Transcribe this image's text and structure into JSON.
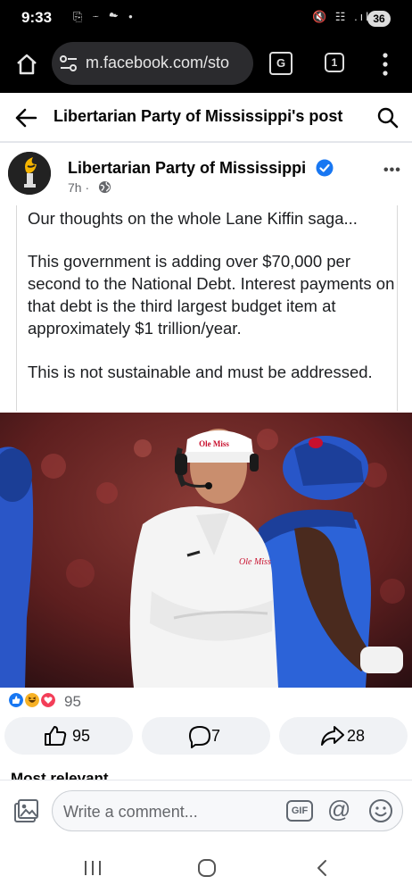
{
  "status_bar": {
    "time": "9:33",
    "left_icons": "⎘ ⁓ ☁ •",
    "right_icons": "🔇 ☷ .ıl",
    "battery": "36"
  },
  "browser": {
    "url": "m.facebook.com/sto",
    "translate_label": "G",
    "tab_count": "1"
  },
  "header": {
    "title": "Libertarian Party of Mississippi's post"
  },
  "post": {
    "author": "Libertarian Party of Mississippi",
    "time": "7h",
    "dot": "·",
    "more": "•••",
    "paragraphs": [
      "Our thoughts on the whole Lane Kiffin saga...",
      "This government is adding over $70,000 per second to the National Debt. Interest payments on that debt is the third largest budget item at approximately $1 trillion/year.",
      "This is not sustainable and must be addressed."
    ],
    "photo_hat_text": "Ole Miss"
  },
  "engagement": {
    "reaction_count": "95",
    "like_count": "95",
    "comment_count": "7",
    "share_count": "28",
    "most_relevant": "Most relevant"
  },
  "comment_bar": {
    "placeholder": "Write a comment...",
    "gif_label": "GIF",
    "at_label": "@"
  },
  "colors": {
    "fb_blue": "#1877f2",
    "muted": "#65676b",
    "button_bg": "#f0f2f5"
  }
}
